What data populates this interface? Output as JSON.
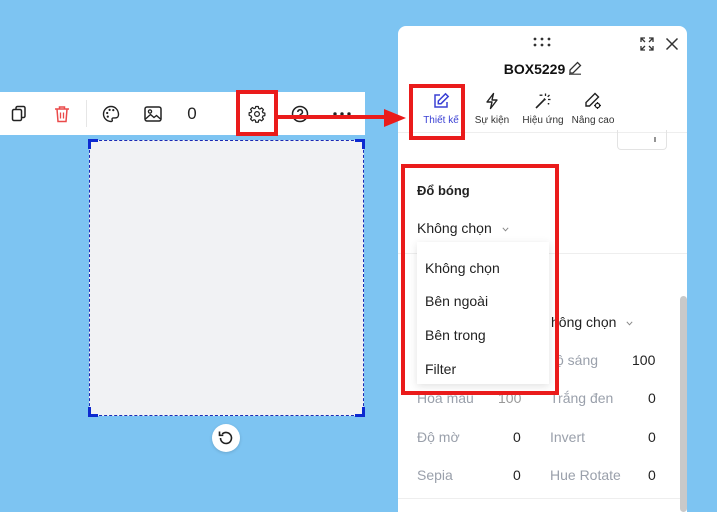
{
  "toolbar": {
    "counter": "0",
    "icons": [
      "copy-icon",
      "trash-icon",
      "palette-icon",
      "image-icon",
      "gear-icon",
      "help-icon",
      "more-icon"
    ]
  },
  "panel": {
    "title": "BOX5229",
    "tabs": [
      {
        "label": "Thiết kế",
        "icon": "pencil-square-icon",
        "active": true
      },
      {
        "label": "Sự kiện",
        "icon": "lightning-icon",
        "active": false
      },
      {
        "label": "Hiệu ứng",
        "icon": "magic-wand-icon",
        "active": false
      },
      {
        "label": "Nâng cao",
        "icon": "gear-pencil-icon",
        "active": false
      }
    ],
    "shadow_section": {
      "title": "Đổ bóng",
      "selected": "Không chọn",
      "options": [
        "Không chọn",
        "Bên ngoài",
        "Bên trong",
        "Filter"
      ]
    },
    "filter_select_value": "hông chọn",
    "filters": [
      {
        "label": "ộ sáng",
        "value": "100"
      },
      {
        "label": "Hòa màu",
        "value": "100"
      },
      {
        "label": "Trắng đen",
        "value": "0"
      },
      {
        "label": "Độ mờ",
        "value": "0"
      },
      {
        "label": "Invert",
        "value": "0"
      },
      {
        "label": "Sepia",
        "value": "0"
      },
      {
        "label": "Hue Rotate",
        "value": "0"
      }
    ]
  },
  "colors": {
    "background": "#7dc4f2",
    "highlight": "#ea1b1b",
    "accent": "#3a40d4",
    "selection": "#1a2bb5"
  }
}
